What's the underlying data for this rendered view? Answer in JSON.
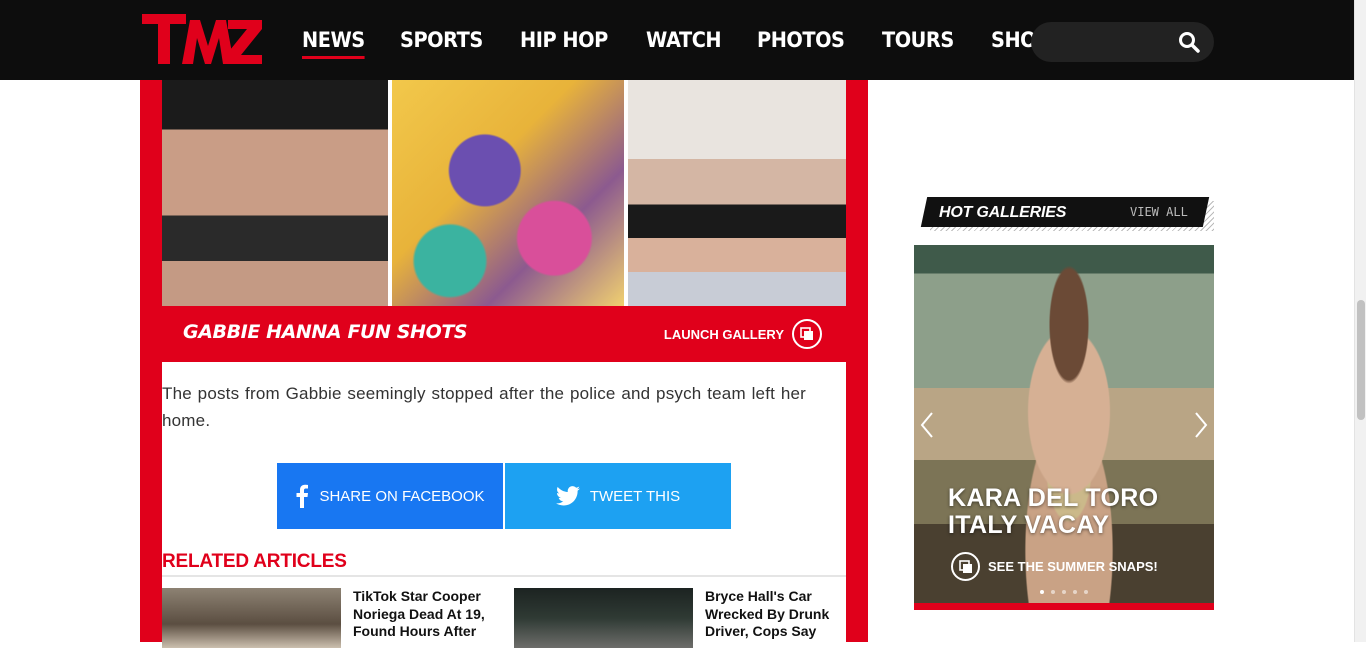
{
  "header": {
    "logo_text": "TMZ",
    "nav": [
      "NEWS",
      "SPORTS",
      "HIP HOP",
      "WATCH",
      "PHOTOS",
      "TOURS",
      "SHOP"
    ],
    "active_nav": "NEWS",
    "search": {
      "placeholder": "",
      "icon": "search-icon"
    }
  },
  "gallery": {
    "title": "GABBIE HANNA FUN SHOTS",
    "launch_label": "LAUNCH GALLERY",
    "launch_icon": "gallery-icon"
  },
  "article": {
    "paragraph": "The posts from Gabbie seemingly stopped after the police and psych team left her home."
  },
  "share": {
    "facebook_label": "SHARE ON FACEBOOK",
    "twitter_label": "TWEET THIS"
  },
  "related": {
    "heading": "RELATED ARTICLES",
    "items": [
      {
        "title": "TikTok Star Cooper Noriega Dead At 19, Found Hours After"
      },
      {
        "title": "Bryce Hall's Car Wrecked By Drunk Driver, Cops Say"
      }
    ]
  },
  "sidebar": {
    "hot_galleries_label": "HOT GALLERIES",
    "view_all_label": "VIEW ALL",
    "slide": {
      "headline_line1": "KARA DEL TORO",
      "headline_line2": "ITALY VACAY",
      "cta": "SEE THE SUMMER SNAPS!",
      "dots_total": 5,
      "dots_active": 1
    }
  },
  "colors": {
    "brand_red": "#e0001b",
    "facebook": "#1877f2",
    "twitter": "#1da1f2",
    "header_bg": "#0d0d0d"
  }
}
